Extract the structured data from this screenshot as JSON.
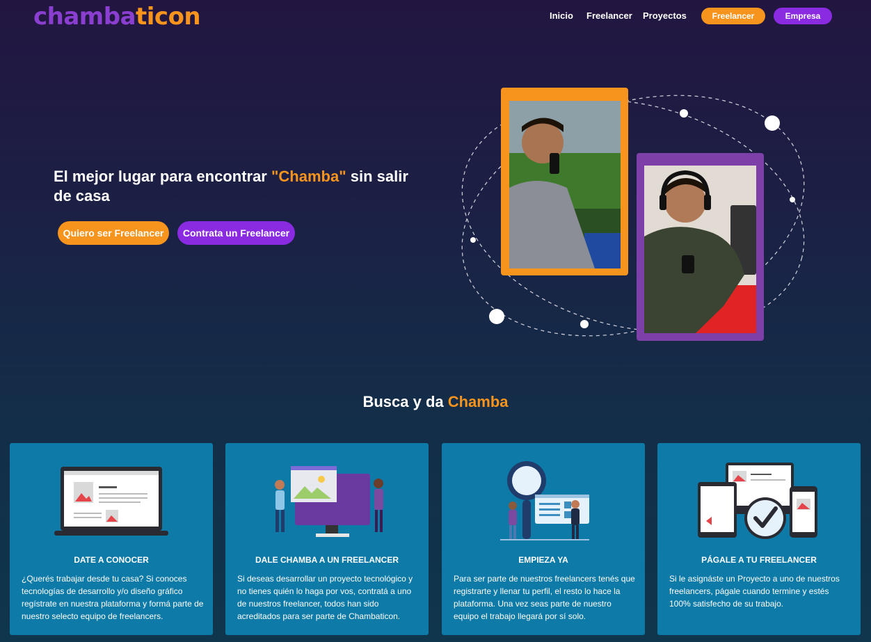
{
  "brand": {
    "logo_part1": "chamba",
    "logo_part2": "ticon"
  },
  "nav": {
    "links": [
      "Inicio",
      "Freelancer",
      "Proyectos"
    ],
    "btn_freelancer": "Freelancer",
    "btn_empresa": "Empresa"
  },
  "hero": {
    "title_before": "El mejor lugar para encontrar ",
    "title_highlight": "\"Chamba\"",
    "title_after": " sin salir de casa",
    "btn_freelancer": "Quiero ser Freelancer",
    "btn_contract": "Contrata un Freelancer"
  },
  "section": {
    "title_before": "Busca y da ",
    "title_highlight": "Chamba"
  },
  "cards": [
    {
      "title": "DATE A CONOCER",
      "text": "¿Querés trabajar desde tu casa? Si conoces tecnologías de desarrollo y/o diseño gráfico regístrate en nuestra plataforma y formá parte de nuestro selecto equipo de freelancers."
    },
    {
      "title": "DALE CHAMBA A UN FREELANCER",
      "text": "Si deseas desarrollar un proyecto tecnológico y no tienes quién lo haga por vos, contratá a uno de nuestros freelancer, todos han sido acreditados para ser parte de Chambaticon."
    },
    {
      "title": "EMPIEZA YA",
      "text": "Para ser parte de nuestros freelancers tenés que registrarte y llenar tu perfil, el resto lo hace la plataforma. Una vez seas parte de nuestro equipo el trabajo llegará por sí solo."
    },
    {
      "title": "PÁGALE A TU FREELANCER",
      "text": "Si le asignáste un Proyecto a uno de nuestros freelancers, págale cuando termine y estés 100% satisfecho de su trabajo."
    }
  ],
  "colors": {
    "accent_orange": "#f7941d",
    "accent_purple": "#8a2be2",
    "card_bg": "#0e7aa8"
  }
}
